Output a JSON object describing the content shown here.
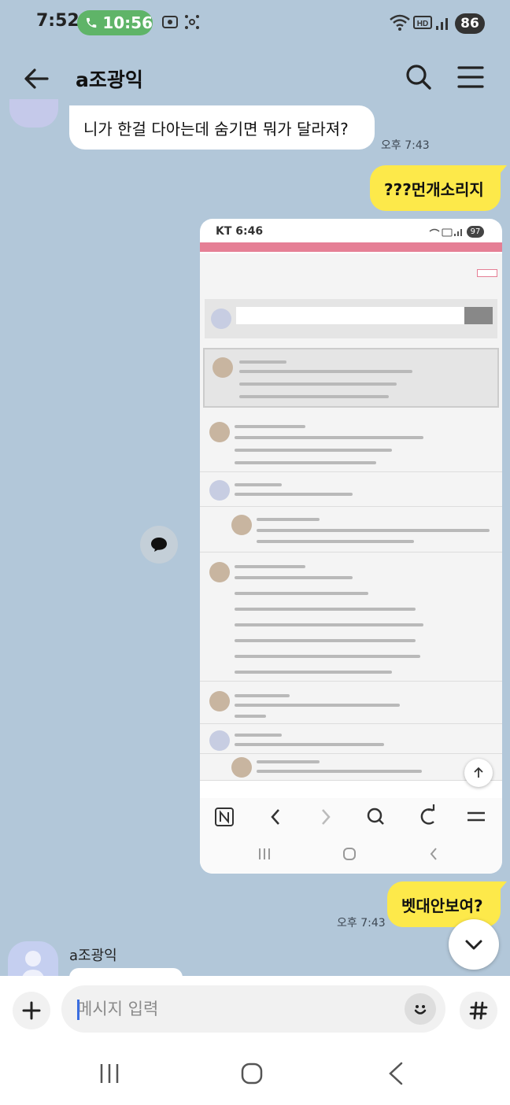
{
  "status": {
    "time": "7:52",
    "call_time": "10:56",
    "battery": "86"
  },
  "header": {
    "title": "a조광익"
  },
  "messages": {
    "m1_text": "니가 한걸 다아는데 숨기면 뭐가 달라져?",
    "m1_time": "오후 7:43",
    "m2_text": "???먼개소리지",
    "m3_text": "벳대안보여?",
    "m3_time": "오후 7:43",
    "sender_name": "a조광익"
  },
  "shared_screenshot": {
    "time": "KT 6:46",
    "battery": "97"
  },
  "input": {
    "placeholder": "메시지 입력"
  },
  "icons": {
    "back": "back-arrow-icon",
    "search": "search-icon",
    "menu": "hamburger-menu-icon",
    "comment": "comment-icon",
    "scroll_down": "chevron-down-icon",
    "plus": "plus-icon",
    "emoji": "emoji-icon",
    "hash": "hash-icon",
    "call": "phone-icon",
    "wifi": "wifi-icon",
    "hd": "hd-icon",
    "signal": "signal-icon"
  },
  "colors": {
    "background": "#b2c7d9",
    "my_bubble": "#fde94a",
    "their_bubble": "#ffffff",
    "call_pill": "#5fb468"
  }
}
